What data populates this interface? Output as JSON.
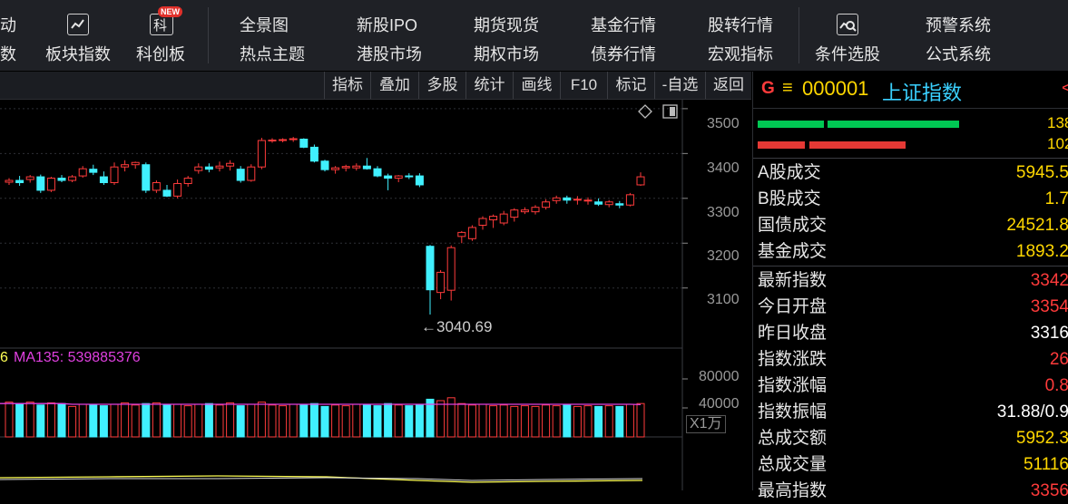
{
  "top_nav": {
    "partial1": "动",
    "partial2": "数",
    "sector_index": "板块指数",
    "star_market": "科创板",
    "star_icon_char": "科",
    "new_badge": "NEW",
    "panorama": "全景图",
    "hot_topics": "热点主题",
    "new_ipo": "新股IPO",
    "hk_market": "港股市场",
    "futures_spot": "期货现货",
    "options_market": "期权市场",
    "fund_quotes": "基金行情",
    "bond_quotes": "债券行情",
    "stock_transfer": "股转行情",
    "macro_indicators": "宏观指标",
    "condition_stock_pick": "条件选股",
    "alert_system": "预警系统",
    "formula_system": "公式系统"
  },
  "toolbar": [
    "指标",
    "叠加",
    "多股",
    "统计",
    "画线",
    "F10",
    "标记",
    "-自选",
    "返回"
  ],
  "chart": {
    "y_ticks": [
      "3500",
      "3400",
      "3300",
      "3200",
      "3100"
    ],
    "low_annotation": "←3040.69",
    "vol_label_partial": "6",
    "vol_indicator": "MA135: 539885376",
    "vol_ticks": [
      "80000",
      "40000"
    ],
    "vol_unit": "X1万",
    "colors": {
      "up": "#ff3b3b",
      "down": "#40f0ff",
      "ma_line": "#e040e0",
      "volma_line": "#ffff55"
    }
  },
  "chart_data": {
    "type": "candlestick",
    "series_candles": [
      {
        "o": 3336,
        "h": 3345,
        "l": 3330,
        "c": 3340
      },
      {
        "o": 3340,
        "h": 3350,
        "l": 3328,
        "c": 3335
      },
      {
        "o": 3342,
        "h": 3352,
        "l": 3335,
        "c": 3348
      },
      {
        "o": 3348,
        "h": 3353,
        "l": 3312,
        "c": 3318
      },
      {
        "o": 3318,
        "h": 3348,
        "l": 3314,
        "c": 3345
      },
      {
        "o": 3345,
        "h": 3352,
        "l": 3336,
        "c": 3340
      },
      {
        "o": 3340,
        "h": 3352,
        "l": 3336,
        "c": 3348
      },
      {
        "o": 3350,
        "h": 3372,
        "l": 3346,
        "c": 3366
      },
      {
        "o": 3365,
        "h": 3375,
        "l": 3352,
        "c": 3358
      },
      {
        "o": 3348,
        "h": 3360,
        "l": 3330,
        "c": 3335
      },
      {
        "o": 3335,
        "h": 3380,
        "l": 3330,
        "c": 3370
      },
      {
        "o": 3370,
        "h": 3385,
        "l": 3360,
        "c": 3375
      },
      {
        "o": 3375,
        "h": 3382,
        "l": 3366,
        "c": 3380
      },
      {
        "o": 3375,
        "h": 3380,
        "l": 3312,
        "c": 3318
      },
      {
        "o": 3318,
        "h": 3340,
        "l": 3312,
        "c": 3335
      },
      {
        "o": 3318,
        "h": 3330,
        "l": 3303,
        "c": 3305
      },
      {
        "o": 3305,
        "h": 3342,
        "l": 3300,
        "c": 3333
      },
      {
        "o": 3333,
        "h": 3350,
        "l": 3326,
        "c": 3345
      },
      {
        "o": 3362,
        "h": 3378,
        "l": 3355,
        "c": 3370
      },
      {
        "o": 3370,
        "h": 3378,
        "l": 3358,
        "c": 3365
      },
      {
        "o": 3368,
        "h": 3382,
        "l": 3360,
        "c": 3372
      },
      {
        "o": 3372,
        "h": 3385,
        "l": 3362,
        "c": 3378
      },
      {
        "o": 3365,
        "h": 3372,
        "l": 3335,
        "c": 3340
      },
      {
        "o": 3340,
        "h": 3376,
        "l": 3337,
        "c": 3370
      },
      {
        "o": 3370,
        "h": 3435,
        "l": 3365,
        "c": 3429
      },
      {
        "o": 3429,
        "h": 3434,
        "l": 3424,
        "c": 3430
      },
      {
        "o": 3430,
        "h": 3434,
        "l": 3425,
        "c": 3431
      },
      {
        "o": 3432,
        "h": 3437,
        "l": 3426,
        "c": 3433
      },
      {
        "o": 3432,
        "h": 3434,
        "l": 3412,
        "c": 3414
      },
      {
        "o": 3414,
        "h": 3420,
        "l": 3380,
        "c": 3383
      },
      {
        "o": 3383,
        "h": 3386,
        "l": 3360,
        "c": 3364
      },
      {
        "o": 3364,
        "h": 3372,
        "l": 3355,
        "c": 3368
      },
      {
        "o": 3368,
        "h": 3375,
        "l": 3360,
        "c": 3371
      },
      {
        "o": 3368,
        "h": 3378,
        "l": 3362,
        "c": 3372
      },
      {
        "o": 3372,
        "h": 3390,
        "l": 3364,
        "c": 3366
      },
      {
        "o": 3366,
        "h": 3372,
        "l": 3347,
        "c": 3350
      },
      {
        "o": 3350,
        "h": 3355,
        "l": 3318,
        "c": 3345
      },
      {
        "o": 3345,
        "h": 3352,
        "l": 3336,
        "c": 3350
      },
      {
        "o": 3350,
        "h": 3356,
        "l": 3343,
        "c": 3348
      },
      {
        "o": 3350,
        "h": 3356,
        "l": 3325,
        "c": 3330
      },
      {
        "o": 3193,
        "h": 3196,
        "l": 3040.69,
        "c": 3096
      },
      {
        "o": 3090,
        "h": 3140,
        "l": 3075,
        "c": 3135
      },
      {
        "o": 3095,
        "h": 3195,
        "l": 3072,
        "c": 3190
      },
      {
        "o": 3215,
        "h": 3227,
        "l": 3200,
        "c": 3224
      },
      {
        "o": 3210,
        "h": 3240,
        "l": 3205,
        "c": 3235
      },
      {
        "o": 3240,
        "h": 3260,
        "l": 3230,
        "c": 3255
      },
      {
        "o": 3252,
        "h": 3264,
        "l": 3234,
        "c": 3260
      },
      {
        "o": 3245,
        "h": 3272,
        "l": 3240,
        "c": 3265
      },
      {
        "o": 3258,
        "h": 3278,
        "l": 3248,
        "c": 3274
      },
      {
        "o": 3270,
        "h": 3280,
        "l": 3265,
        "c": 3274
      },
      {
        "o": 3270,
        "h": 3285,
        "l": 3264,
        "c": 3280
      },
      {
        "o": 3280,
        "h": 3298,
        "l": 3275,
        "c": 3292
      },
      {
        "o": 3295,
        "h": 3306,
        "l": 3288,
        "c": 3301
      },
      {
        "o": 3301,
        "h": 3306,
        "l": 3288,
        "c": 3296
      },
      {
        "o": 3296,
        "h": 3305,
        "l": 3286,
        "c": 3298
      },
      {
        "o": 3294,
        "h": 3302,
        "l": 3286,
        "c": 3296
      },
      {
        "o": 3292,
        "h": 3300,
        "l": 3283,
        "c": 3287
      },
      {
        "o": 3286,
        "h": 3296,
        "l": 3280,
        "c": 3292
      },
      {
        "o": 3288,
        "h": 3294,
        "l": 3278,
        "c": 3285
      },
      {
        "o": 3285,
        "h": 3312,
        "l": 3282,
        "c": 3308
      },
      {
        "o": 3330,
        "h": 3358,
        "l": 3328,
        "c": 3348
      }
    ],
    "volumes": [
      48,
      45,
      48,
      44,
      47,
      46,
      42,
      45,
      44,
      43,
      45,
      47,
      44,
      46,
      47,
      44,
      45,
      43,
      45,
      46,
      44,
      47,
      43,
      45,
      48,
      44,
      43,
      45,
      44,
      46,
      42,
      44,
      43,
      45,
      44,
      43,
      46,
      44,
      43,
      44,
      52,
      50,
      54,
      46,
      44,
      45,
      43,
      44,
      42,
      43,
      42,
      44,
      43,
      44,
      42,
      43,
      42,
      43,
      42,
      45,
      46
    ],
    "volume_ma": [
      46,
      46,
      46,
      46,
      46,
      46,
      45,
      45,
      45,
      45,
      45,
      45,
      45,
      45,
      45,
      45,
      45,
      45,
      45,
      45,
      45,
      45,
      45,
      45,
      45,
      45,
      45,
      45,
      45,
      45,
      45,
      45,
      45,
      45,
      45,
      45,
      45,
      45,
      45,
      45,
      45,
      45,
      45,
      45,
      45,
      45,
      45,
      45,
      45,
      45,
      45,
      45,
      45,
      45,
      45,
      45,
      45,
      45,
      45,
      45,
      44.5
    ],
    "ylim": [
      2970,
      3520
    ],
    "vol_ylim": [
      0,
      100
    ]
  },
  "quote": {
    "code": "000001",
    "name": "上证指数",
    "g_icon": "G",
    "menu_icon": "≡",
    "partial_value": "<s",
    "bars": [
      {
        "value": "138"
      },
      {
        "value": "102"
      }
    ],
    "volumes": [
      {
        "label": "A股成交",
        "value": "5945.5"
      },
      {
        "label": "B股成交",
        "value": "1.7"
      },
      {
        "label": "国债成交",
        "value": "24521.8"
      },
      {
        "label": "基金成交",
        "value": "1893.2"
      }
    ],
    "stats": [
      {
        "label": "最新指数",
        "value": "3342"
      },
      {
        "label": "今日开盘",
        "value": "3354"
      },
      {
        "label": "昨日收盘",
        "value": "3316"
      },
      {
        "label": "指数涨跌",
        "value": "26"
      },
      {
        "label": "指数涨幅",
        "value": "0.8"
      },
      {
        "label": "指数振幅",
        "value": "31.88/0.9"
      },
      {
        "label": "总成交额",
        "value": "5952.3"
      },
      {
        "label": "总成交量",
        "value": "51116"
      },
      {
        "label": "最高指数",
        "value": "3356"
      }
    ]
  }
}
